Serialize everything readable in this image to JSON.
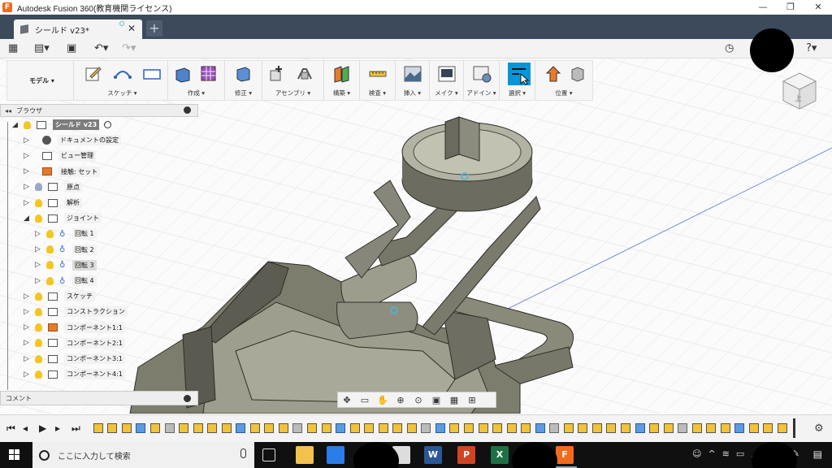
{
  "window": {
    "title": "Autodesk Fusion 360(教育機関ライセンス)",
    "logo_letter": "F",
    "controls": [
      "—",
      "❐",
      "✕"
    ]
  },
  "tabs": [
    {
      "label": "シールド v23*",
      "close": "✕"
    }
  ],
  "new_tab_label": "+",
  "toolbar": {
    "mode_label": "モデル ▾",
    "groups": [
      {
        "label": "スケッチ ▾"
      },
      {
        "label": "作成 ▾"
      },
      {
        "label": "修正 ▾"
      },
      {
        "label": "アセンブリ ▾"
      },
      {
        "label": "構築 ▾"
      },
      {
        "label": "検査 ▾"
      },
      {
        "label": "挿入 ▾"
      },
      {
        "label": "メイク ▾"
      },
      {
        "label": "アドイン ▾"
      },
      {
        "label": "選択 ▾"
      },
      {
        "label": "位置 ▾"
      }
    ]
  },
  "browser": {
    "title": "ブラウザ",
    "collapse": "◂◂",
    "items": [
      {
        "label": "シールド v23",
        "level": 0,
        "expanded": true,
        "icon": "component-icon",
        "bulb": true,
        "root": true
      },
      {
        "label": "ドキュメントの設定",
        "level": 1,
        "icon": "gear-icon",
        "bulb": false
      },
      {
        "label": "ビュー管理",
        "level": 1,
        "icon": "folder-icon",
        "bulb": false
      },
      {
        "label": "接触: セット",
        "level": 1,
        "icon": "contact-set-icon",
        "bulb": false
      },
      {
        "label": "原点",
        "level": 1,
        "icon": "folder-icon",
        "bulb": "off"
      },
      {
        "label": "解析",
        "level": 1,
        "icon": "folder-icon",
        "bulb": true
      },
      {
        "label": "ジョイント",
        "level": 1,
        "icon": "folder-icon",
        "bulb": true,
        "expanded": true
      },
      {
        "label": "回転 1",
        "level": 2,
        "icon": "joint-icon",
        "bulb": true
      },
      {
        "label": "回転 2",
        "level": 2,
        "icon": "joint-icon",
        "bulb": true
      },
      {
        "label": "回転 3",
        "level": 2,
        "icon": "joint-icon",
        "bulb": true,
        "selected": true
      },
      {
        "label": "回転 4",
        "level": 2,
        "icon": "joint-icon",
        "bulb": true
      },
      {
        "label": "スケッチ",
        "level": 1,
        "icon": "folder-icon",
        "bulb": true
      },
      {
        "label": "コンストラクション",
        "level": 1,
        "icon": "folder-icon",
        "bulb": true
      },
      {
        "label": "コンポーネント1:1",
        "level": 1,
        "icon": "component-link-icon",
        "bulb": true
      },
      {
        "label": "コンポーネント2:1",
        "level": 1,
        "icon": "component-icon",
        "bulb": true
      },
      {
        "label": "コンポーネント3:1",
        "level": 1,
        "icon": "component-icon",
        "bulb": true
      },
      {
        "label": "コンポーネント4:1",
        "level": 1,
        "icon": "component-icon",
        "bulb": true
      }
    ]
  },
  "comments": {
    "label": "コメント"
  },
  "navbar": {
    "icons": [
      "orbit-icon",
      "look-at-icon",
      "pan-icon",
      "zoom-icon",
      "fit-icon",
      "display-settings-icon",
      "grid-icon",
      "viewports-icon"
    ]
  },
  "viewcube": {
    "face_label": "上"
  },
  "timeline": {
    "controls": [
      "⏮",
      "◂",
      "▶",
      "▸",
      "⏭"
    ],
    "item_count": 49
  },
  "taskbar": {
    "search_placeholder": "ここに入力して検索",
    "apps": [
      "task-view-icon",
      "explorer-icon",
      "store-icon",
      "mail-icon",
      "word-icon",
      "powerpoint-icon",
      "excel-icon",
      "fusion-icon"
    ],
    "word_letter": "W",
    "ppt_letter": "P",
    "excel_letter": "X",
    "fusion_letter": "F"
  },
  "colors": {
    "tab_bar": "#3c4a5c",
    "model_dark": "#5a5a52",
    "model_mid": "#868677",
    "model_light": "#a8a899",
    "accent_select": "#0696d7",
    "fusion_orange": "#f26b1d"
  }
}
